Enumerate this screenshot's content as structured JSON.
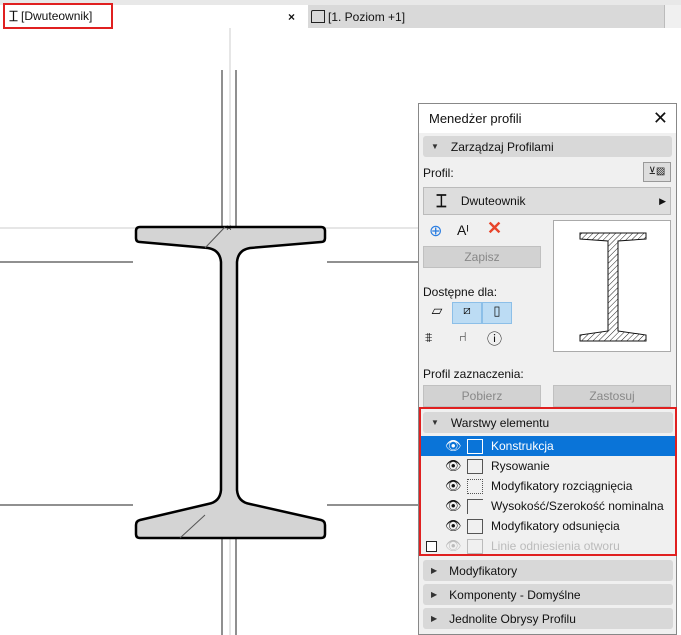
{
  "tabs": [
    {
      "label": "[Dwuteownik]",
      "icon": "ibeam-icon",
      "close": "×"
    },
    {
      "label": "[1. Poziom +1]",
      "icon": "floor-plan-icon"
    }
  ],
  "panel": {
    "title": "Menedżer profili",
    "manage_section": "Zarządzaj Profilami",
    "profile_label": "Profil:",
    "profile_name": "Dwuteownik",
    "save_button": "Zapisz",
    "available_for": "Dostępne dla:",
    "selection_profile": "Profil zaznaczenia:",
    "get_button": "Pobierz",
    "apply_button": "Zastosuj",
    "layers_section": "Warstwy elementu",
    "layers": [
      {
        "label": "Konstrukcja",
        "visible": true,
        "selected": true
      },
      {
        "label": "Rysowanie",
        "visible": true
      },
      {
        "label": "Modyfikatory rozciągnięcia",
        "visible": true
      },
      {
        "label": "Wysokość/Szerokość nominalna",
        "visible": true
      },
      {
        "label": "Modyfikatory odsunięcia",
        "visible": true
      },
      {
        "label": "Linie odniesienia otworu",
        "visible": false,
        "checked": false
      }
    ],
    "collapsed_sections": [
      "Modyfikatory",
      "Komponenty - Domyślne",
      "Jednolite Obrysy Profilu"
    ]
  },
  "colors": {
    "selection": "#0a74d8",
    "highlight": "#e02020",
    "delete": "#e8442a",
    "add": "#2a7de1"
  }
}
